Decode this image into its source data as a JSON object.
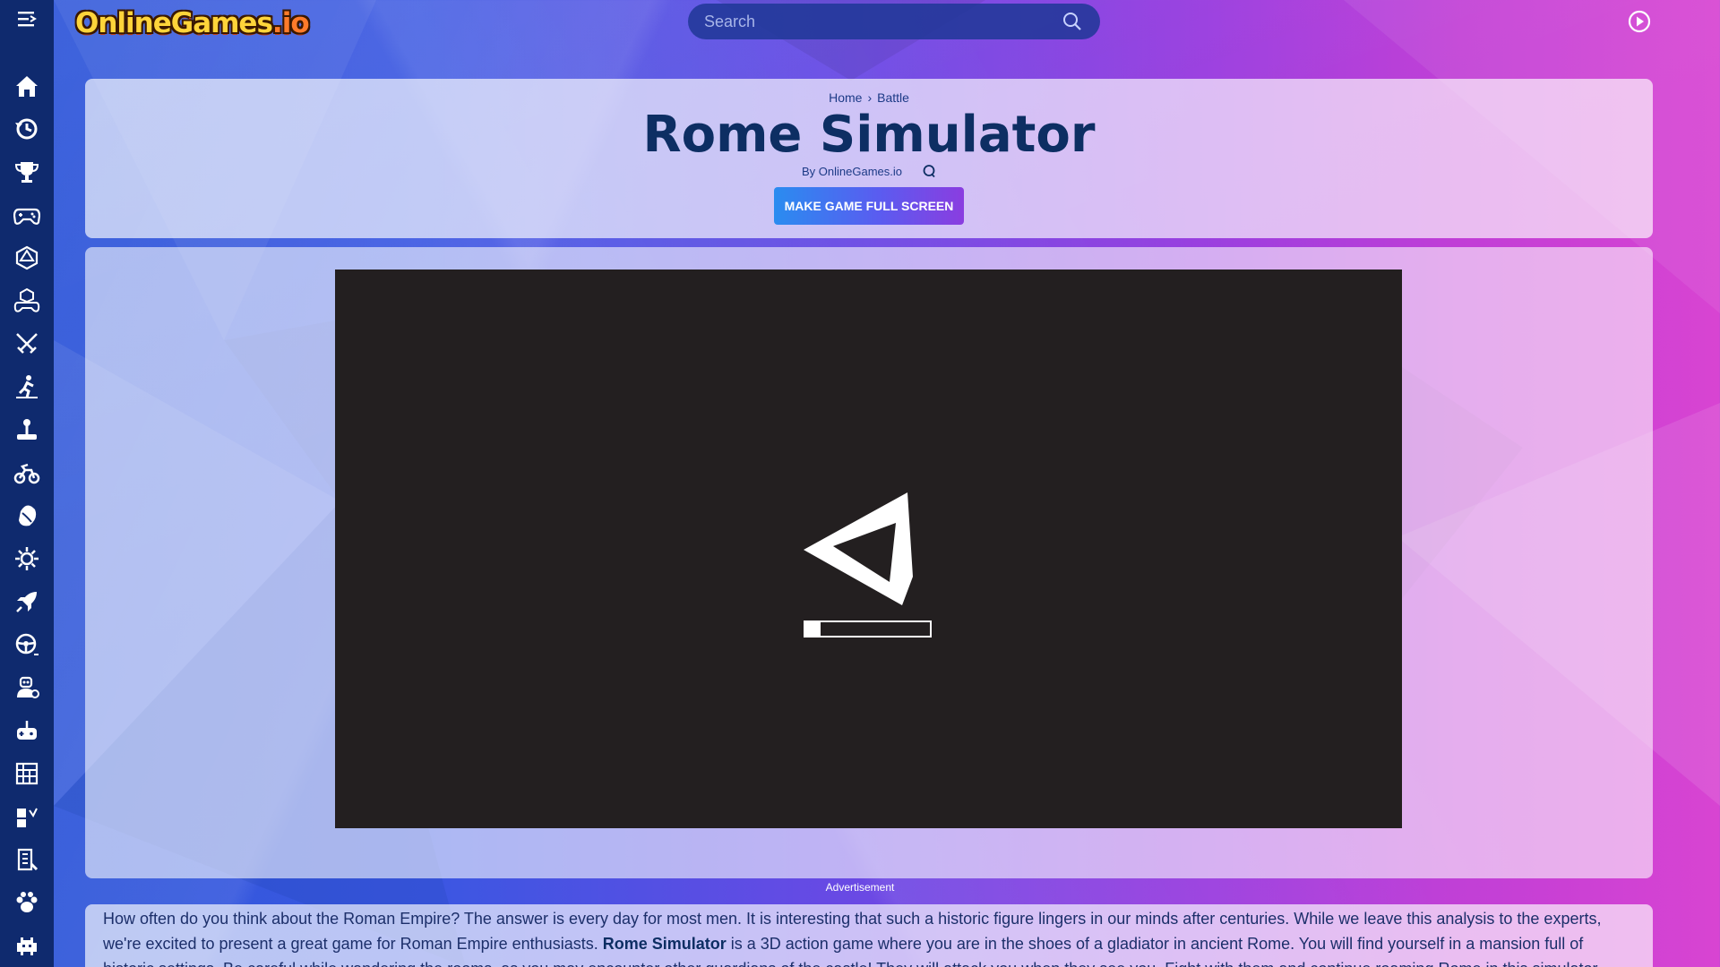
{
  "brand": {
    "logo_main": "OnlineGames",
    "logo_suffix": ".io"
  },
  "search": {
    "placeholder": "Search"
  },
  "sidebar": {
    "icons": [
      "home-icon",
      "history-icon",
      "trophy-icon",
      "gamepad-icon",
      "dice-icon",
      "puzzle-controller-icon",
      "crossed-swords-icon",
      "runner-icon",
      "joystick-icon",
      "motorbike-icon",
      "ball-icon",
      "gear-icon",
      "rocket-icon",
      "steering-wheel-icon",
      "robot-icon",
      "controller-plus-icon",
      "tower-icon",
      "blocks-icon",
      "building-icon",
      "paw-icon",
      "pixel-monster-icon"
    ]
  },
  "breadcrumb": {
    "home": "Home",
    "separator": "›",
    "category": "Battle"
  },
  "game": {
    "title": "Rome Simulator",
    "byline": "By OnlineGames.io",
    "fullscreen_label": "MAKE GAME FULL SCREEN",
    "loading_progress": 0.12
  },
  "ad_label": "Advertisement",
  "description": {
    "part1": "How often do you think about the Roman Empire? The answer is every day for most men. It is interesting that such a historic figure lingers in our minds after centuries. While we leave this analysis to the experts, we're excited to present a great game for Roman Empire enthusiasts. ",
    "bold": "Rome Simulator",
    "part2": " is a 3D action game where you are in the shoes of a gladiator in ancient Rome. You will find yourself in a mansion full of historic settings. Be careful while wandering the rooms, as you may encounter other guardians of the castle! They will attack you when they see you. Fight with them and continue roaming Rome in this simulator game!"
  },
  "colors": {
    "sidebar_bg": "#0f2a6e",
    "title": "#0d2e63",
    "game_bg": "#231f20",
    "button_gradient_start": "#2a8cf0",
    "button_gradient_end": "#8a3de0"
  }
}
